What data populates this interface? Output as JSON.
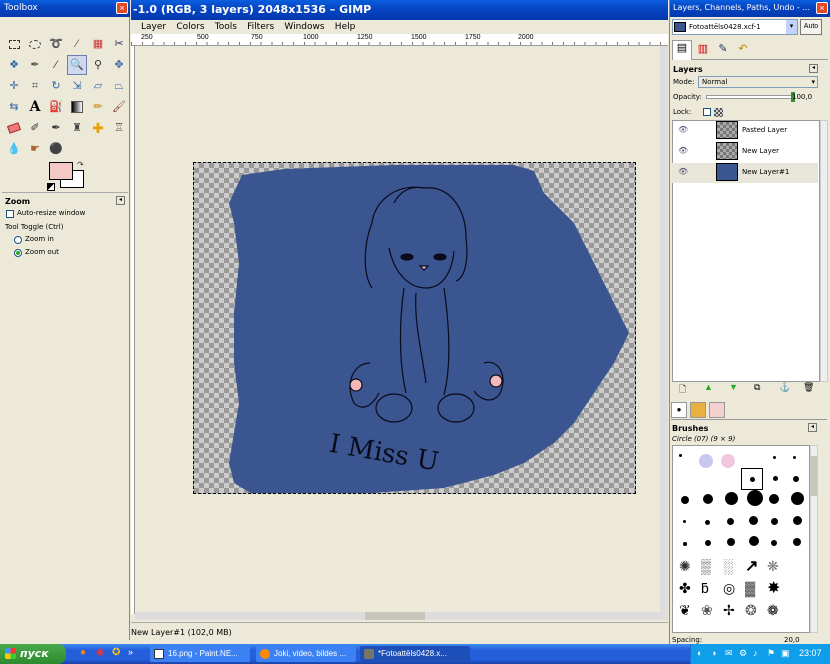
{
  "toolbox": {
    "title": "Toolbox",
    "zoom": {
      "heading": "Zoom",
      "auto_resize": "Auto-resize window",
      "tool_toggle": "Tool Toggle  (Ctrl)",
      "zoom_in": "Zoom in",
      "zoom_out": "Zoom out"
    },
    "fg_color": "#f4c8c4",
    "bg_color": "#ffffff"
  },
  "image_window": {
    "title": "-1.0 (RGB, 3 layers) 2048x1536 – GIMP",
    "menu": [
      "Layer",
      "Colors",
      "Tools",
      "Filters",
      "Windows",
      "Help"
    ],
    "ruler_ticks": [
      "250",
      "500",
      "750",
      "1000",
      "1250",
      "1500",
      "1750",
      "2000"
    ],
    "status": "New Layer#1 (102,0 MB)",
    "canvas_text": "I Miss U",
    "fill_color": "#3b5591"
  },
  "layers_dock": {
    "title": "Layers, Channels, Paths, Undo - ...",
    "image_selector": "Fotoattēls0428.xcf-1",
    "auto_label": "Auto",
    "layers_heading": "Layers",
    "mode_label": "Mode:",
    "mode_value": "Normal",
    "opacity_label": "Opacity:",
    "opacity_value": "100,0",
    "lock_label": "Lock:",
    "layers": [
      {
        "name": "Pasted Layer"
      },
      {
        "name": "New Layer"
      },
      {
        "name": "New Layer#1"
      }
    ],
    "brushes_heading": "Brushes",
    "brush_selected": "Circle (07) (9 × 9)",
    "spacing_label": "Spacing:",
    "spacing_value": "20,0"
  },
  "taskbar": {
    "start": "пуск",
    "items": [
      "16.png - Paint.NE...",
      "Joki, video, bildes ...",
      "*Fotoattēls0428.x..."
    ],
    "clock": "23:07"
  }
}
